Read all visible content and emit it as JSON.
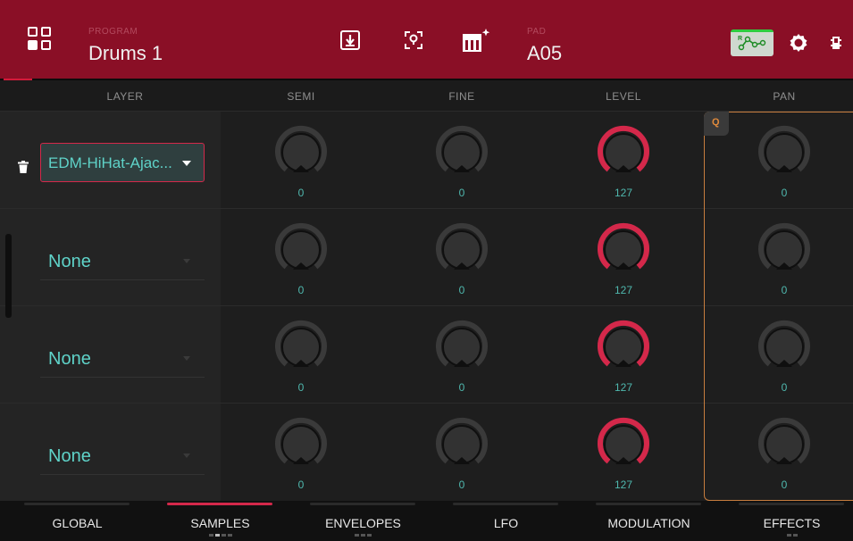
{
  "header": {
    "program_caption": "PROGRAM",
    "program_name": "Drums 1",
    "pad_caption": "PAD",
    "pad_name": "A05",
    "icons": [
      "grid-menu-icon",
      "download-icon",
      "locate-icon",
      "keyboard-sparkle-icon",
      "automation-icon",
      "gear-icon",
      "battery-icon"
    ]
  },
  "columns": {
    "layer": "LAYER",
    "semi": "SEMI",
    "fine": "FINE",
    "level": "LEVEL",
    "pan": "PAN"
  },
  "qlink_badge": "Q",
  "layers": [
    {
      "sample": "EDM-HiHat-Ajac...",
      "semi": "0",
      "fine": "0",
      "level": "127",
      "pan": "0"
    },
    {
      "sample": "None",
      "semi": "0",
      "fine": "0",
      "level": "127",
      "pan": "0"
    },
    {
      "sample": "None",
      "semi": "0",
      "fine": "0",
      "level": "127",
      "pan": "0"
    },
    {
      "sample": "None",
      "semi": "0",
      "fine": "0",
      "level": "127",
      "pan": "0"
    }
  ],
  "tabs": [
    {
      "label": "GLOBAL",
      "active": false
    },
    {
      "label": "SAMPLES",
      "active": true
    },
    {
      "label": "ENVELOPES",
      "active": false
    },
    {
      "label": "LFO",
      "active": false
    },
    {
      "label": "MODULATION",
      "active": false
    },
    {
      "label": "EFFECTS",
      "active": false
    }
  ],
  "colors": {
    "header": "#8a0f26",
    "accent_red": "#d4284a",
    "value_teal": "#4fb8ae",
    "qlink_orange": "#c77d3e"
  }
}
